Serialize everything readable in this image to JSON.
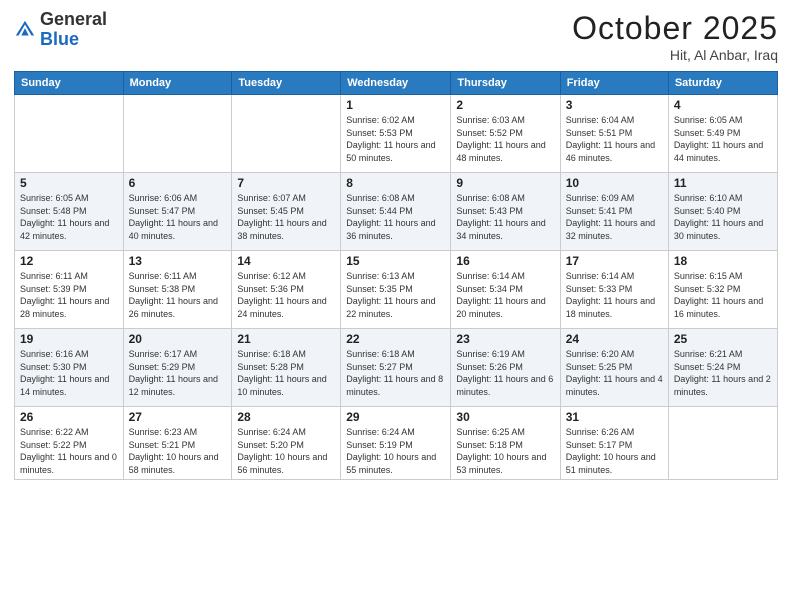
{
  "header": {
    "logo_general": "General",
    "logo_blue": "Blue",
    "month": "October 2025",
    "location": "Hit, Al Anbar, Iraq"
  },
  "weekdays": [
    "Sunday",
    "Monday",
    "Tuesday",
    "Wednesday",
    "Thursday",
    "Friday",
    "Saturday"
  ],
  "weeks": [
    [
      {
        "day": "",
        "info": ""
      },
      {
        "day": "",
        "info": ""
      },
      {
        "day": "",
        "info": ""
      },
      {
        "day": "1",
        "info": "Sunrise: 6:02 AM\nSunset: 5:53 PM\nDaylight: 11 hours and 50 minutes."
      },
      {
        "day": "2",
        "info": "Sunrise: 6:03 AM\nSunset: 5:52 PM\nDaylight: 11 hours and 48 minutes."
      },
      {
        "day": "3",
        "info": "Sunrise: 6:04 AM\nSunset: 5:51 PM\nDaylight: 11 hours and 46 minutes."
      },
      {
        "day": "4",
        "info": "Sunrise: 6:05 AM\nSunset: 5:49 PM\nDaylight: 11 hours and 44 minutes."
      }
    ],
    [
      {
        "day": "5",
        "info": "Sunrise: 6:05 AM\nSunset: 5:48 PM\nDaylight: 11 hours and 42 minutes."
      },
      {
        "day": "6",
        "info": "Sunrise: 6:06 AM\nSunset: 5:47 PM\nDaylight: 11 hours and 40 minutes."
      },
      {
        "day": "7",
        "info": "Sunrise: 6:07 AM\nSunset: 5:45 PM\nDaylight: 11 hours and 38 minutes."
      },
      {
        "day": "8",
        "info": "Sunrise: 6:08 AM\nSunset: 5:44 PM\nDaylight: 11 hours and 36 minutes."
      },
      {
        "day": "9",
        "info": "Sunrise: 6:08 AM\nSunset: 5:43 PM\nDaylight: 11 hours and 34 minutes."
      },
      {
        "day": "10",
        "info": "Sunrise: 6:09 AM\nSunset: 5:41 PM\nDaylight: 11 hours and 32 minutes."
      },
      {
        "day": "11",
        "info": "Sunrise: 6:10 AM\nSunset: 5:40 PM\nDaylight: 11 hours and 30 minutes."
      }
    ],
    [
      {
        "day": "12",
        "info": "Sunrise: 6:11 AM\nSunset: 5:39 PM\nDaylight: 11 hours and 28 minutes."
      },
      {
        "day": "13",
        "info": "Sunrise: 6:11 AM\nSunset: 5:38 PM\nDaylight: 11 hours and 26 minutes."
      },
      {
        "day": "14",
        "info": "Sunrise: 6:12 AM\nSunset: 5:36 PM\nDaylight: 11 hours and 24 minutes."
      },
      {
        "day": "15",
        "info": "Sunrise: 6:13 AM\nSunset: 5:35 PM\nDaylight: 11 hours and 22 minutes."
      },
      {
        "day": "16",
        "info": "Sunrise: 6:14 AM\nSunset: 5:34 PM\nDaylight: 11 hours and 20 minutes."
      },
      {
        "day": "17",
        "info": "Sunrise: 6:14 AM\nSunset: 5:33 PM\nDaylight: 11 hours and 18 minutes."
      },
      {
        "day": "18",
        "info": "Sunrise: 6:15 AM\nSunset: 5:32 PM\nDaylight: 11 hours and 16 minutes."
      }
    ],
    [
      {
        "day": "19",
        "info": "Sunrise: 6:16 AM\nSunset: 5:30 PM\nDaylight: 11 hours and 14 minutes."
      },
      {
        "day": "20",
        "info": "Sunrise: 6:17 AM\nSunset: 5:29 PM\nDaylight: 11 hours and 12 minutes."
      },
      {
        "day": "21",
        "info": "Sunrise: 6:18 AM\nSunset: 5:28 PM\nDaylight: 11 hours and 10 minutes."
      },
      {
        "day": "22",
        "info": "Sunrise: 6:18 AM\nSunset: 5:27 PM\nDaylight: 11 hours and 8 minutes."
      },
      {
        "day": "23",
        "info": "Sunrise: 6:19 AM\nSunset: 5:26 PM\nDaylight: 11 hours and 6 minutes."
      },
      {
        "day": "24",
        "info": "Sunrise: 6:20 AM\nSunset: 5:25 PM\nDaylight: 11 hours and 4 minutes."
      },
      {
        "day": "25",
        "info": "Sunrise: 6:21 AM\nSunset: 5:24 PM\nDaylight: 11 hours and 2 minutes."
      }
    ],
    [
      {
        "day": "26",
        "info": "Sunrise: 6:22 AM\nSunset: 5:22 PM\nDaylight: 11 hours and 0 minutes."
      },
      {
        "day": "27",
        "info": "Sunrise: 6:23 AM\nSunset: 5:21 PM\nDaylight: 10 hours and 58 minutes."
      },
      {
        "day": "28",
        "info": "Sunrise: 6:24 AM\nSunset: 5:20 PM\nDaylight: 10 hours and 56 minutes."
      },
      {
        "day": "29",
        "info": "Sunrise: 6:24 AM\nSunset: 5:19 PM\nDaylight: 10 hours and 55 minutes."
      },
      {
        "day": "30",
        "info": "Sunrise: 6:25 AM\nSunset: 5:18 PM\nDaylight: 10 hours and 53 minutes."
      },
      {
        "day": "31",
        "info": "Sunrise: 6:26 AM\nSunset: 5:17 PM\nDaylight: 10 hours and 51 minutes."
      },
      {
        "day": "",
        "info": ""
      }
    ]
  ]
}
